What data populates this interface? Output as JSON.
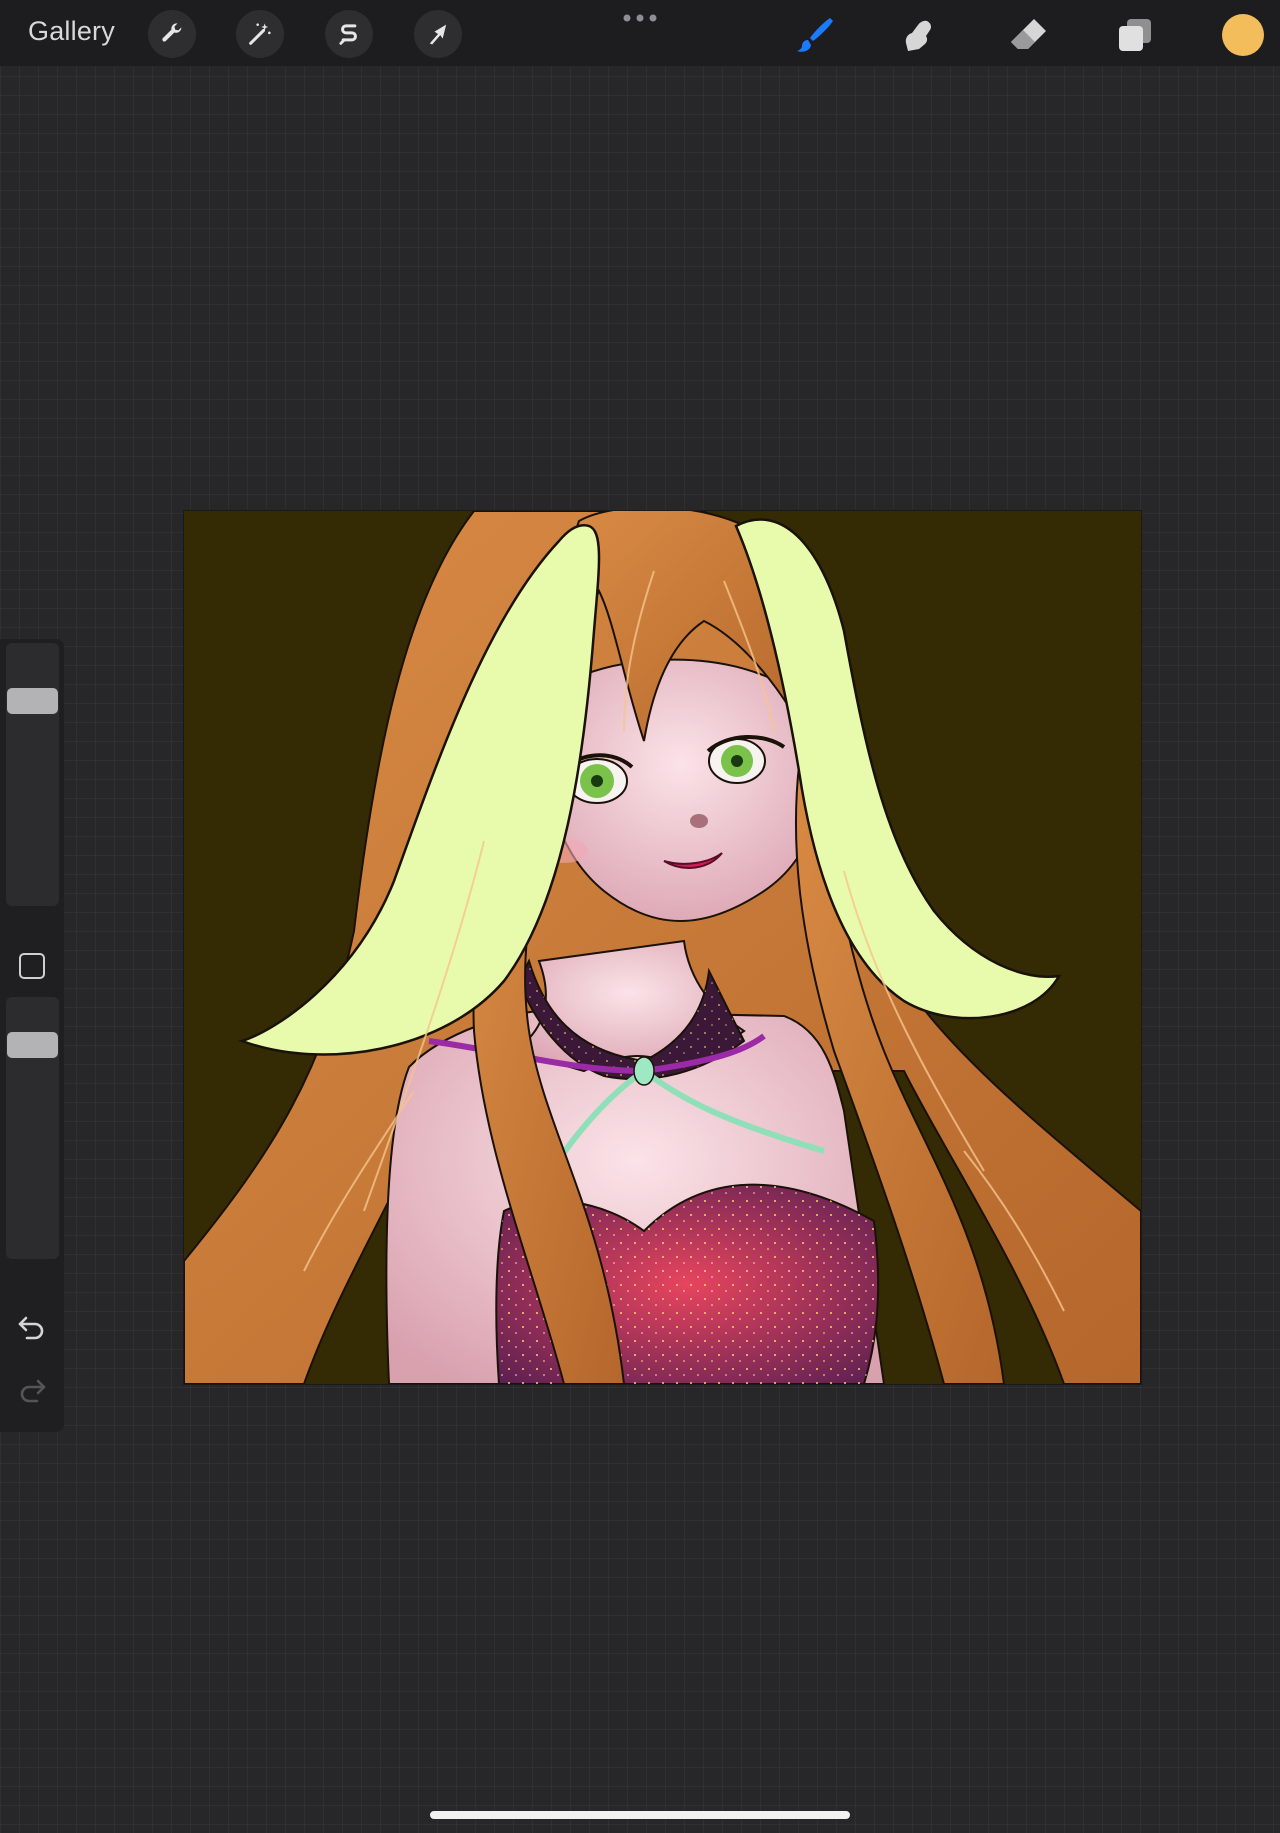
{
  "toolbar": {
    "gallery_label": "Gallery",
    "left_tools": [
      {
        "name": "actions",
        "icon": "wrench-icon"
      },
      {
        "name": "adjustments",
        "icon": "magic-wand-icon"
      },
      {
        "name": "selection",
        "icon": "selection-s-icon"
      },
      {
        "name": "transform",
        "icon": "arrow-cursor-icon"
      }
    ],
    "more_icon": "more-dots-icon",
    "right_tools": [
      {
        "name": "brush",
        "icon": "brush-icon",
        "active": true,
        "color": "#1a7bff"
      },
      {
        "name": "smudge",
        "icon": "smudge-finger-icon",
        "active": false
      },
      {
        "name": "eraser",
        "icon": "eraser-icon",
        "active": false
      },
      {
        "name": "layers",
        "icon": "layers-icon",
        "active": false
      }
    ],
    "current_color": "#f3bd5c"
  },
  "sidebar": {
    "brush_size_icon": "brush-size-slider",
    "modify_icon": "square-modify-icon",
    "opacity_icon": "opacity-slider",
    "undo_icon": "undo-arrow-icon",
    "redo_icon": "redo-arrow-icon"
  },
  "canvas": {
    "background_color": "#342b05",
    "subject": "illustration"
  },
  "colors": {
    "workspace": "#27272a",
    "toolbar": "#1d1d1f",
    "hair": "#c87a3a",
    "ears": "#e8fbad",
    "skin": "#f3cfd6",
    "dress": "#b02a5a"
  }
}
